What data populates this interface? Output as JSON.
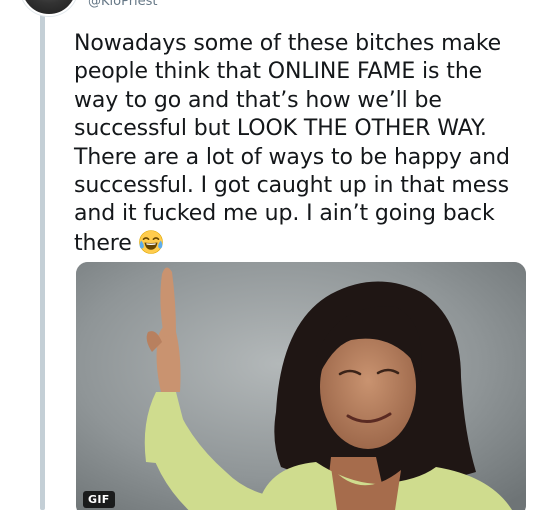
{
  "tweet": {
    "handle": "@KloPriest",
    "text_lines": [
      "Nowadays some of these bitches make",
      "people think that ONLINE FAME is the",
      "way to go and that’s how we’ll be",
      "successful but LOOK THE OTHER WAY.",
      "There are a lot of ways to be happy and",
      "successful. I got caught up in that mess",
      "and it fucked me up. I ain’t going back",
      "there"
    ],
    "emoji": "face-with-tears-of-joy-icon",
    "media": {
      "type": "gif",
      "badge": "GIF"
    }
  },
  "colors": {
    "text": "#14171a",
    "handle": "#657786",
    "thread_line": "#c4cfd6",
    "cardigan": "#cfdc8e"
  }
}
